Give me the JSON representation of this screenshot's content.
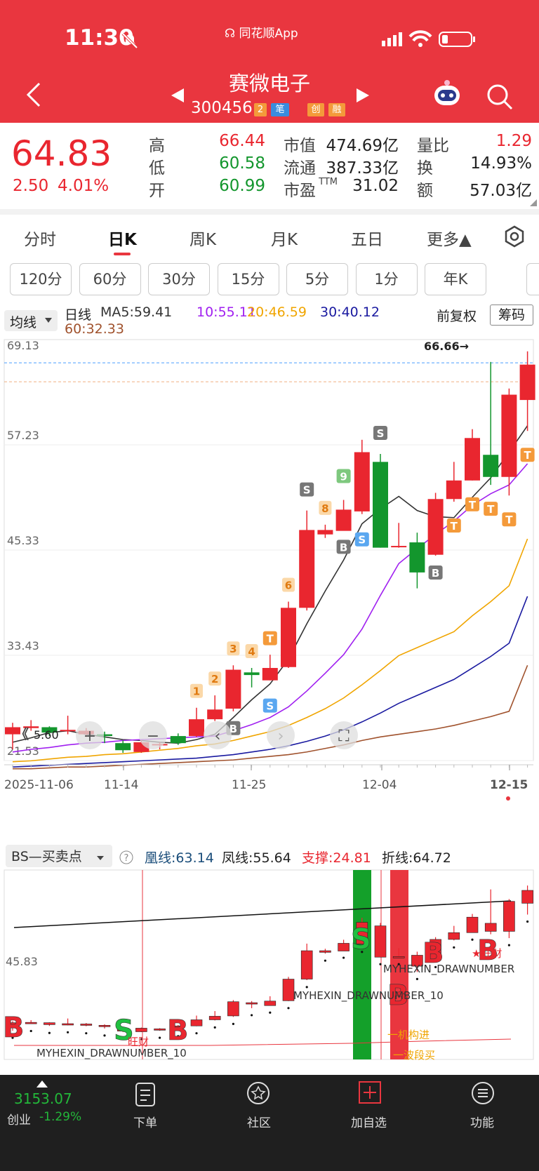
{
  "status": {
    "time": "11:30",
    "app_name": "同花顺App"
  },
  "header": {
    "title": "赛微电子",
    "code": "300456",
    "tags": [
      "2",
      "笔",
      "创",
      "融"
    ]
  },
  "quote": {
    "price": "64.83",
    "change": "2.50",
    "change_pct": "4.01%",
    "fields": [
      {
        "l": "高",
        "v": "66.44",
        "c": "red"
      },
      {
        "l": "低",
        "v": "60.58",
        "c": "green"
      },
      {
        "l": "开",
        "v": "60.99",
        "c": "green"
      },
      {
        "l": "市值",
        "v": "474.69亿",
        "c": "dark"
      },
      {
        "l": "流通",
        "v": "387.33亿",
        "c": "dark"
      },
      {
        "l": "市盈TTM",
        "v": "31.02",
        "c": "dark"
      },
      {
        "l": "量比",
        "v": "1.29",
        "c": "red"
      },
      {
        "l": "换",
        "v": "14.93%",
        "c": "dark"
      },
      {
        "l": "额",
        "v": "57.03亿",
        "c": "dark"
      }
    ]
  },
  "tabs": [
    "分时",
    "日K",
    "周K",
    "月K",
    "五日",
    "更多▲"
  ],
  "active_tab": "日K",
  "periods": [
    "120分",
    "60分",
    "30分",
    "15分",
    "5分",
    "1分",
    "年K"
  ],
  "ma": {
    "selector": "均线",
    "label": "日线",
    "ma5": "MA5:59.41",
    "ma10": "10:55.11",
    "ma20": "20:46.59",
    "ma30": "30:40.12",
    "ma60": "60:32.33",
    "fq": "前复权",
    "chip": "筹码"
  },
  "chart_data": {
    "type": "candlestick",
    "y_ticks": [
      "69.13",
      "57.23",
      "45.33",
      "33.43",
      "21.53"
    ],
    "x_ticks": [
      "2025-11-06",
      "11-14",
      "11-25",
      "12-04",
      "12-15"
    ],
    "high_label": "66.66→",
    "candles": [
      [
        24.5,
        25.3,
        25.8,
        22.8
      ],
      [
        25.2,
        25.4,
        26.1,
        24.9
      ],
      [
        25.3,
        24.7,
        25.4,
        24.3
      ],
      [
        25.0,
        25.0,
        26.6,
        24.5
      ],
      [
        24.5,
        24.9,
        25.2,
        24.2
      ],
      [
        24.5,
        24.3,
        24.8,
        23.5
      ],
      [
        23.5,
        22.7,
        23.8,
        22.4
      ],
      [
        22.5,
        23.6,
        23.8,
        22.4
      ],
      [
        23.3,
        23.4,
        23.6,
        22.8
      ],
      [
        24.3,
        23.5,
        24.6,
        23.3
      ],
      [
        24.3,
        26.2,
        27.5,
        24.2
      ],
      [
        26.2,
        27.3,
        28.9,
        26.0
      ],
      [
        27.4,
        31.8,
        32.3,
        27.1
      ],
      [
        31.5,
        31.2,
        32.0,
        29.8
      ],
      [
        30.6,
        32.0,
        33.5,
        30.6
      ],
      [
        32.1,
        38.8,
        39.5,
        32.0
      ],
      [
        38.8,
        47.6,
        49.8,
        38.5
      ],
      [
        47.1,
        47.6,
        48.2,
        46.7
      ],
      [
        47.5,
        49.9,
        51.0,
        47.6
      ],
      [
        49.7,
        56.4,
        57.8,
        49.4
      ],
      [
        55.3,
        45.6,
        56.2,
        45.6
      ],
      [
        45.8,
        45.8,
        48.4,
        45.6
      ],
      [
        46.2,
        42.8,
        47.3,
        41.0
      ],
      [
        44.8,
        51.1,
        51.8,
        44.7
      ],
      [
        51.1,
        53.2,
        55.3,
        50.8
      ],
      [
        53.2,
        58.0,
        59.0,
        53.2
      ],
      [
        56.1,
        53.6,
        66.6,
        52.7
      ],
      [
        53.6,
        62.9,
        63.6,
        51.5
      ],
      [
        62.3,
        66.3,
        67.8,
        58.8
      ]
    ],
    "ma5": [
      23.6,
      24.1,
      24.7,
      24.9,
      24.5,
      24.2,
      23.9,
      23.8,
      23.6,
      23.5,
      23.9,
      24.5,
      26.4,
      28.4,
      30.2,
      33.0,
      37.0,
      40.7,
      44.2,
      48.3,
      50.0,
      51.4,
      49.8,
      49.1,
      49.0,
      51.3,
      53.5,
      56.4,
      59.4
    ],
    "ma10": [
      22.5,
      22.8,
      23.0,
      23.3,
      23.5,
      23.6,
      23.8,
      23.9,
      24.0,
      24.1,
      24.2,
      24.3,
      24.9,
      25.6,
      26.4,
      27.6,
      29.4,
      31.4,
      33.5,
      36.4,
      40.2,
      43.8,
      45.5,
      47.1,
      48.6,
      50.4,
      51.7,
      52.7,
      55.1
    ],
    "ma20": [
      21.4,
      21.5,
      21.7,
      21.9,
      22.0,
      22.2,
      22.3,
      22.5,
      22.7,
      22.9,
      23.2,
      23.4,
      23.8,
      24.3,
      24.8,
      25.5,
      26.4,
      27.4,
      28.6,
      30.1,
      31.7,
      33.4,
      34.3,
      35.2,
      36.1,
      37.9,
      39.5,
      41.3,
      46.6
    ],
    "ma30": [
      20.8,
      20.9,
      21.0,
      21.1,
      21.2,
      21.3,
      21.4,
      21.5,
      21.6,
      21.7,
      21.8,
      22.0,
      22.2,
      22.5,
      22.8,
      23.2,
      23.7,
      24.3,
      25.0,
      25.9,
      26.9,
      28.0,
      28.9,
      29.8,
      30.7,
      32.0,
      33.3,
      34.8,
      40.1
    ],
    "ma60": [
      20.6,
      20.6,
      20.7,
      20.8,
      20.8,
      20.9,
      21.0,
      21.1,
      21.2,
      21.3,
      21.4,
      21.5,
      21.6,
      21.8,
      22.0,
      22.2,
      22.5,
      22.9,
      23.3,
      23.8,
      24.2,
      24.5,
      24.8,
      25.1,
      25.5,
      26.0,
      26.5,
      27.1,
      32.3
    ],
    "signals": [
      {
        "i": 10,
        "t": "1",
        "k": "num"
      },
      {
        "i": 11,
        "t": "2",
        "k": "num"
      },
      {
        "i": 12,
        "t": "3",
        "k": "num"
      },
      {
        "i": 13,
        "t": "4",
        "k": "num"
      },
      {
        "i": 14,
        "t": "T",
        "k": "T"
      },
      {
        "i": 15,
        "t": "6",
        "k": "num"
      },
      {
        "i": 17,
        "t": "8",
        "k": "num"
      },
      {
        "i": 18,
        "t": "9",
        "k": "nine"
      },
      {
        "i": 12,
        "t": "B",
        "k": "B"
      },
      {
        "i": 14,
        "t": "S",
        "k": "Sb"
      },
      {
        "i": 16,
        "t": "S",
        "k": "S"
      },
      {
        "i": 18,
        "t": "B",
        "k": "B"
      },
      {
        "i": 19,
        "t": "S",
        "k": "Sb"
      },
      {
        "i": 20,
        "t": "S",
        "k": "S"
      },
      {
        "i": 23,
        "t": "B",
        "k": "B"
      },
      {
        "i": 24,
        "t": "T",
        "k": "T"
      },
      {
        "i": 25,
        "t": "T",
        "k": "T"
      },
      {
        "i": 26,
        "t": "T",
        "k": "T"
      },
      {
        "i": 27,
        "t": "T",
        "k": "T"
      },
      {
        "i": 28,
        "t": "T",
        "k": "T"
      }
    ]
  },
  "zoom": {
    "left_value": "5.60"
  },
  "indicator": {
    "selector": "BS—买卖点",
    "huang": "凰线:63.14",
    "feng": "凤线:55.64",
    "zhicheng": "支撑:24.81",
    "zhexian": "折线:64.72",
    "y_tick": "45.83",
    "text1": "MYHEXIN_DRAWNUMBER_10",
    "text2": "MYHEXIN_DRAWNUMBER_10",
    "text3": "MYHEXIN_DRAWNUMBER",
    "label_jg": "机构进",
    "label_bd": "波段买",
    "label_wc": "旺财"
  },
  "bottom": {
    "index_value": "3153.07",
    "index_name": "创业",
    "index_change": "-1.29%",
    "items": [
      "下单",
      "社区",
      "加自选",
      "功能"
    ]
  }
}
